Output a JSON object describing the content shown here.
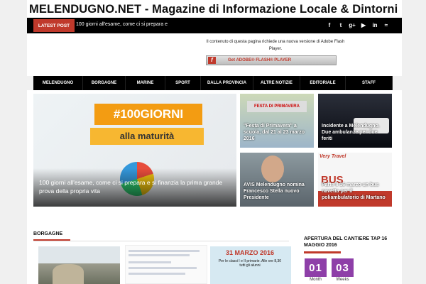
{
  "site": {
    "title": "MELENDUGNO.NET - Magazine di Informazione Locale & Dintorni"
  },
  "topbar": {
    "latest_label": "LATEST POST",
    "latest_text": "100 giorni all'esame, come ci si prepara e",
    "social": [
      {
        "icon": "facebook-icon",
        "glyph": "f"
      },
      {
        "icon": "twitter-icon",
        "glyph": "t"
      },
      {
        "icon": "google-plus-icon",
        "glyph": "g+"
      },
      {
        "icon": "youtube-icon",
        "glyph": "▶"
      },
      {
        "icon": "linkedin-icon",
        "glyph": "in"
      },
      {
        "icon": "rss-icon",
        "glyph": "≈"
      }
    ]
  },
  "ad": {
    "flash_notice": "Il contenuto di questa pagina richiede una nuova versione di Adobe Flash Player.",
    "flash_button": "Get ADOBE® FLASH® PLAYER"
  },
  "nav": [
    "MELENDUGNO",
    "BORGAGNE",
    "MARINE",
    "SPORT",
    "DALLA PROVINCIA",
    "ALTRE NOTIZIE",
    "EDITORIALE",
    "STAFF"
  ],
  "featured": {
    "hero": {
      "tag1": "#100GIORNI",
      "tag2": "alla maturità",
      "caption": "100 giorni all'esame, come ci si prepara e si finanzia la prima grande prova della propria vita"
    },
    "tiles": [
      {
        "caption": "\"Festa di Primavera\" a scuola, dal 21 al 23 marzo 2016",
        "banner": "FESTA DI PRIMAVERA"
      },
      {
        "caption": "Incidente a Melendugno. Due ambulanze per due feriti"
      },
      {
        "caption": "AVIS Melendugno nomina Francesco Stella nuovo Presidente"
      },
      {
        "caption": "Parte il 16 marzo un bus navetta per il poliambulatorio di Martano",
        "logo": "Very Travel",
        "bus": "BUS"
      }
    ]
  },
  "section": {
    "title": "BORGAGNE",
    "thumb3_date": "31 MARZO 2016",
    "thumb3_sub": "Per le classi I e II primarie. Alle ore 8,30 tutti gli alunni"
  },
  "sidebar": {
    "title": "APERTURA DEL CANTIERE TAP 16 MAGGIO 2016",
    "countdown": [
      {
        "value": "01",
        "label": "Month"
      },
      {
        "value": "03",
        "label": "Weeks"
      }
    ]
  }
}
